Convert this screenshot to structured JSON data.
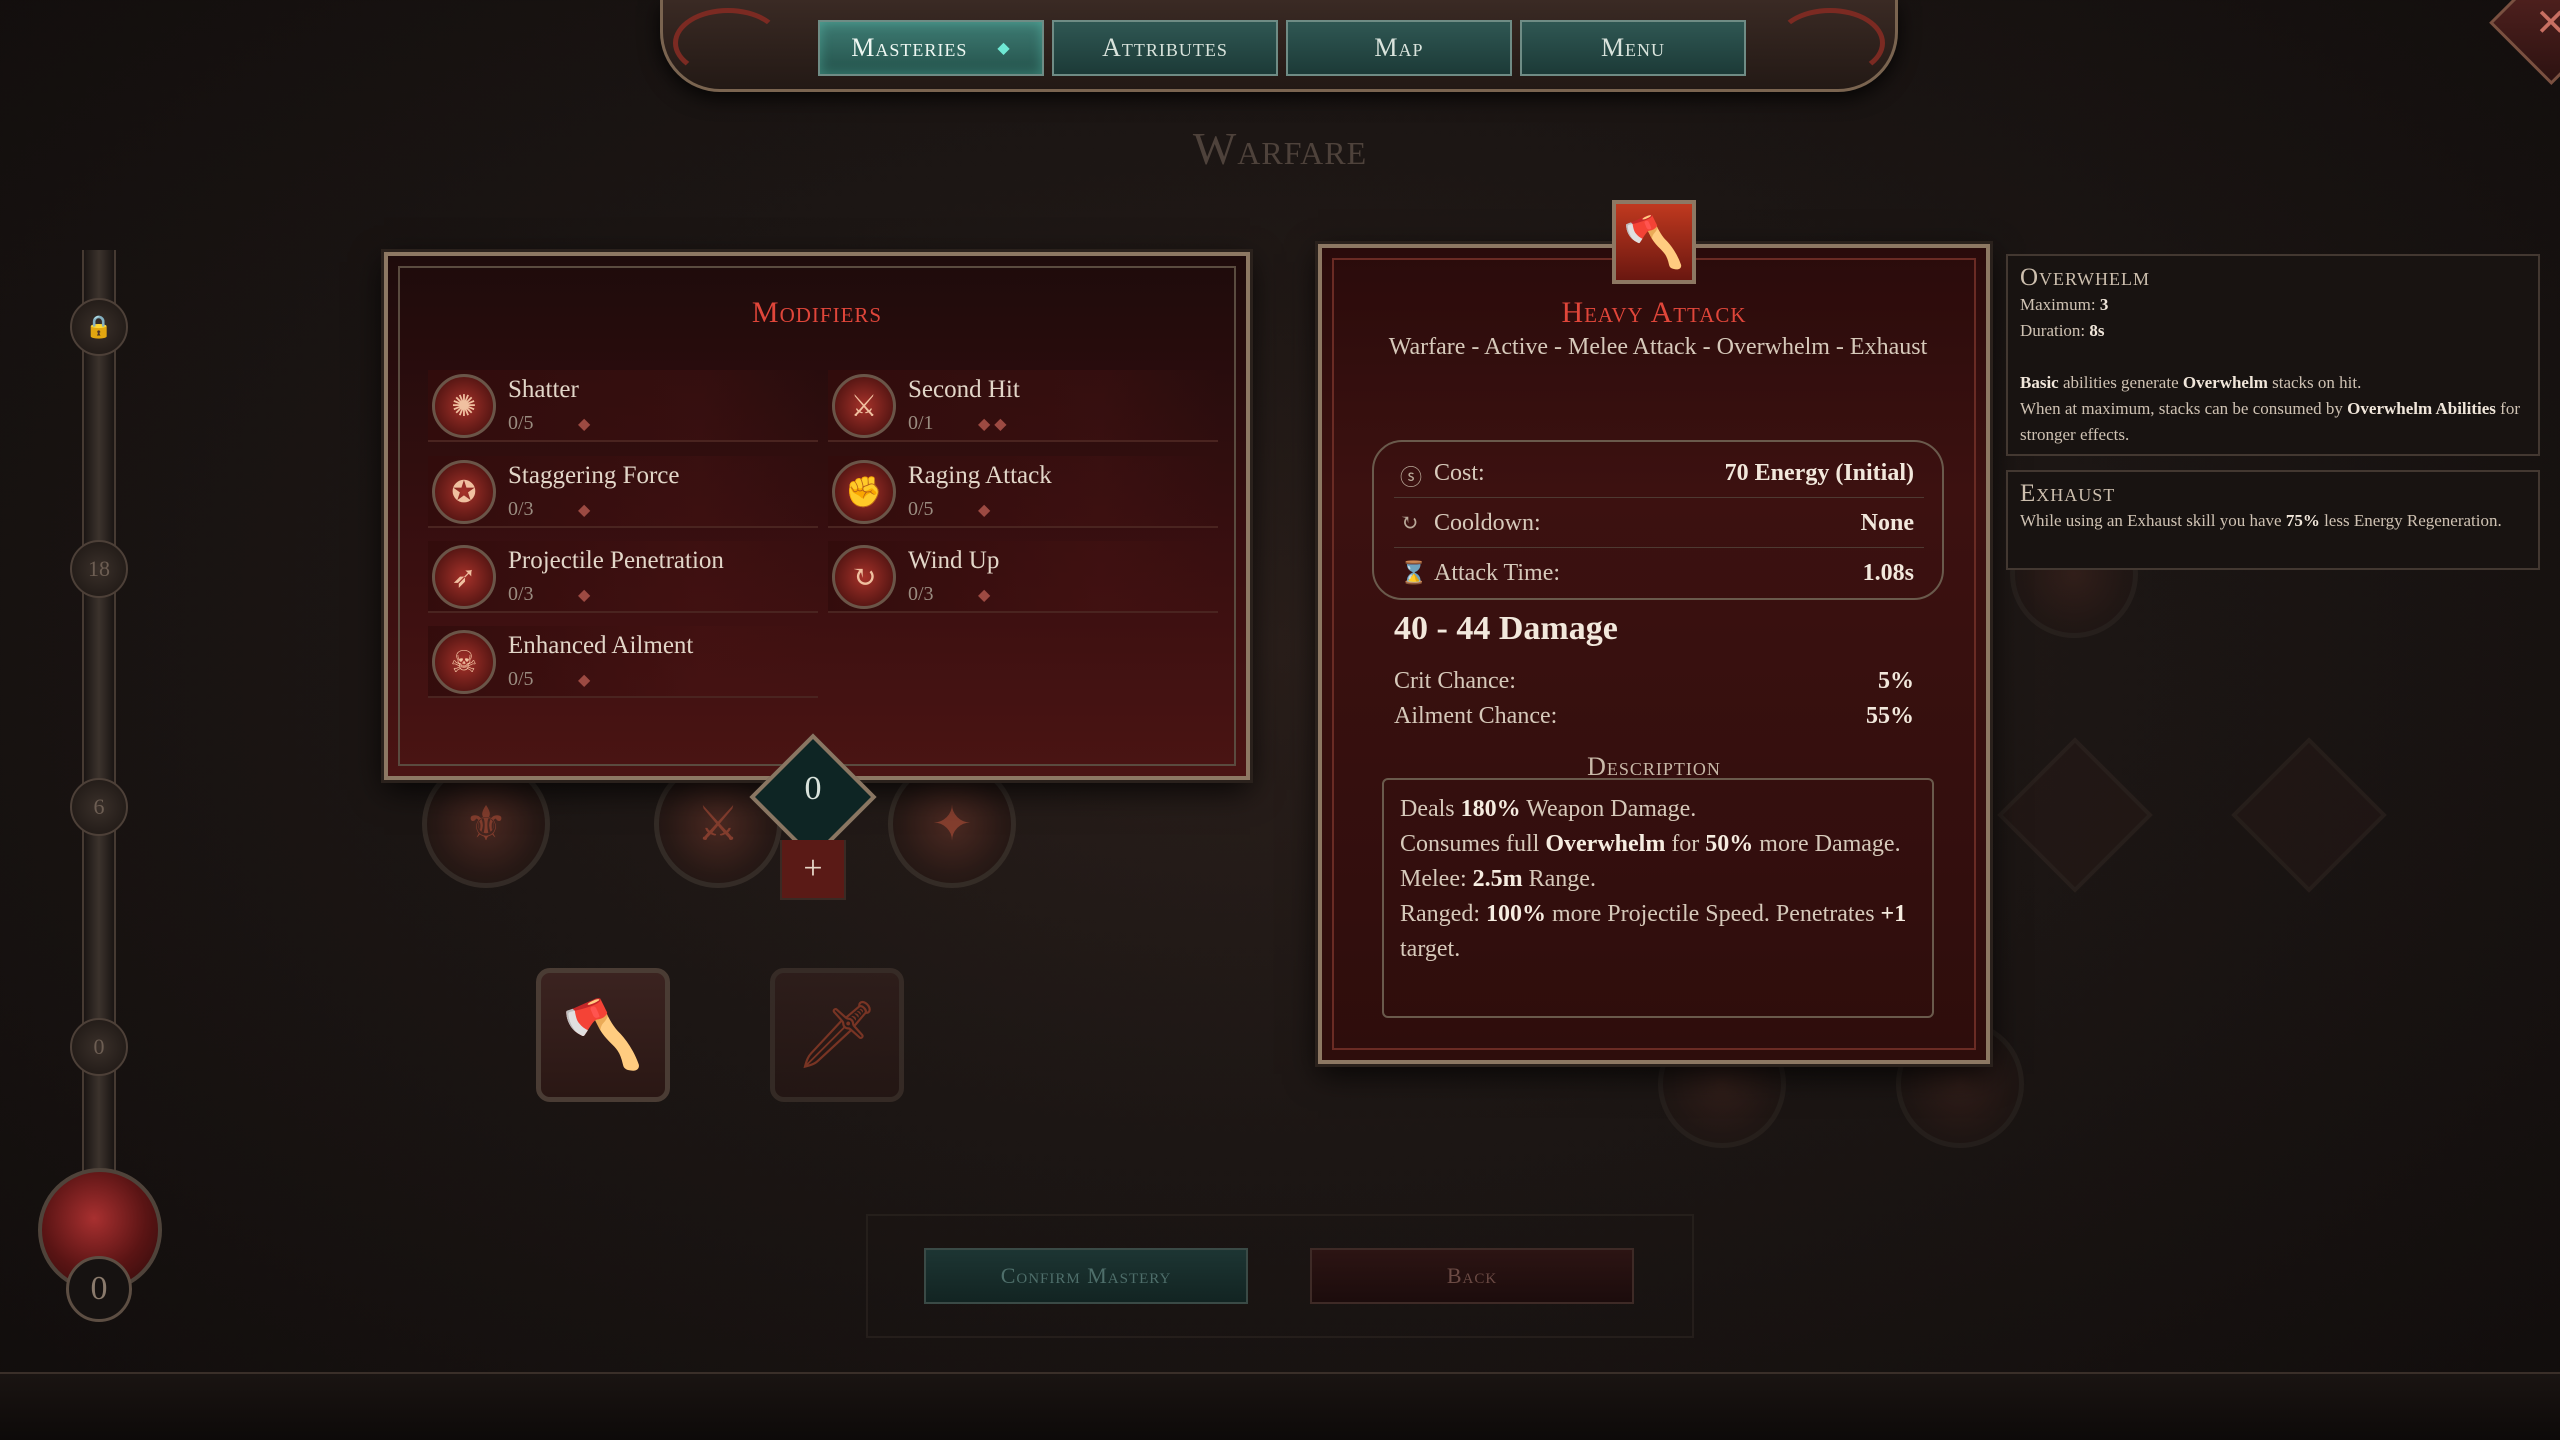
{
  "nav": {
    "tabs": [
      {
        "label": "Masteries",
        "active": true
      },
      {
        "label": "Attributes",
        "active": false
      },
      {
        "label": "Map",
        "active": false
      },
      {
        "label": "Menu",
        "active": false
      }
    ],
    "active_indicator": "◆"
  },
  "close_glyph": "✕",
  "page_title": "Warfare",
  "track_markers": [
    "🔒",
    "18",
    "6",
    "0"
  ],
  "orb_count": "0",
  "modifiers": {
    "title": "Modifiers",
    "items": [
      {
        "name": "Shatter",
        "rank": "0/5",
        "gems": "◆",
        "icon": "burst-icon",
        "glyph": "✺"
      },
      {
        "name": "Second Hit",
        "rank": "0/1",
        "gems": "◆◆",
        "icon": "strike-icon",
        "glyph": "⚔"
      },
      {
        "name": "Staggering Force",
        "rank": "0/3",
        "gems": "◆",
        "icon": "spiral-icon",
        "glyph": "✪"
      },
      {
        "name": "Raging Attack",
        "rank": "0/5",
        "gems": "◆",
        "icon": "fist-icon",
        "glyph": "✊"
      },
      {
        "name": "Projectile Penetration",
        "rank": "0/3",
        "gems": "◆",
        "icon": "arrows-icon",
        "glyph": "➶"
      },
      {
        "name": "Wind Up",
        "rank": "0/3",
        "gems": "◆",
        "icon": "windup-icon",
        "glyph": "↻"
      },
      {
        "name": "Enhanced Ailment",
        "rank": "0/5",
        "gems": "◆",
        "icon": "ailment-icon",
        "glyph": "☠"
      }
    ],
    "points": "0",
    "add_label": "+"
  },
  "attack": {
    "emblem": "🪓",
    "title": "Heavy Attack",
    "tags": "Warfare - Active - Melee Attack - Overwhelm - Exhaust",
    "stats": [
      {
        "icon": "energy-icon",
        "glyph": "ⓢ",
        "label": "Cost:",
        "value": "70 Energy (Initial)"
      },
      {
        "icon": "cooldown-icon",
        "glyph": "↻",
        "label": "Cooldown:",
        "value": "None"
      },
      {
        "icon": "hourglass-icon",
        "glyph": "⌛",
        "label": "Attack Time:",
        "value": "1.08s"
      }
    ],
    "damage": "40 - 44 Damage",
    "crit_label": "Crit Chance:",
    "crit_value": "5%",
    "ailment_label": "Ailment Chance:",
    "ailment_value": "55%",
    "description_heading": "Description",
    "desc": {
      "l1a": "Deals ",
      "l1b": "180%",
      "l1c": " Weapon Damage.",
      "l2a": "Consumes full ",
      "l2b": "Overwhelm",
      "l2c": " for ",
      "l2d": "50%",
      "l2e": " more Damage.",
      "l3a": "Melee: ",
      "l3b": "2.5m",
      "l3c": " Range.",
      "l4a": "Ranged: ",
      "l4b": "100%",
      "l4c": " more Projectile Speed. Penetrates ",
      "l4d": "+1",
      "l4e": " target."
    }
  },
  "tooltips": {
    "overwhelm": {
      "title": "Overwhelm",
      "max_label": "Maximum: ",
      "max_value": "3",
      "dur_label": "Duration: ",
      "dur_value": "8s",
      "p1a": "Basic",
      "p1b": " abilities generate ",
      "p1c": "Overwhelm",
      "p1d": " stacks on hit.",
      "p2a": "When at maximum, stacks can be consumed by ",
      "p2b": "Overwhelm Abilities",
      "p2c": " for stronger effects."
    },
    "exhaust": {
      "title": "Exhaust",
      "p1a": "While using an Exhaust skill you have ",
      "p1b": "75%",
      "p1c": " less Energy Regeneration."
    }
  },
  "buttons": {
    "confirm": "Confirm Mastery",
    "back": "Back"
  }
}
